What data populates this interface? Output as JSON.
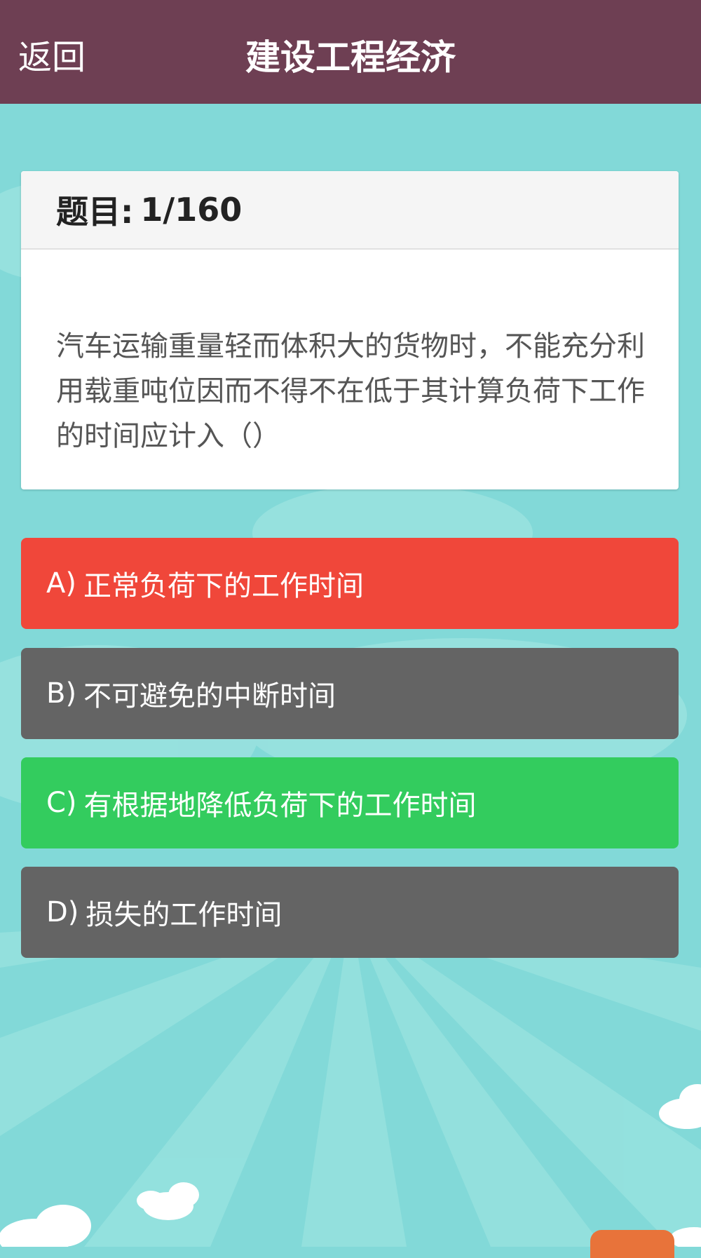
{
  "header": {
    "back_label": "返回",
    "title": "建设工程经济"
  },
  "question": {
    "counter_label": "题目:",
    "counter_value": "1/160",
    "text": "汽车运输重量轻而体积大的货物时，不能充分利用载重吨位因而不得不在低于其计算负荷下工作的时间应计入（）"
  },
  "options": [
    {
      "letter": "A)",
      "text": "正常负荷下的工作时间",
      "state": "wrong"
    },
    {
      "letter": "B)",
      "text": "不可避免的中断时间",
      "state": "neutral"
    },
    {
      "letter": "C)",
      "text": "有根据地降低负荷下的工作时间",
      "state": "correct"
    },
    {
      "letter": "D)",
      "text": "损失的工作时间",
      "state": "neutral"
    }
  ],
  "colors": {
    "header_bg": "#6e3f53",
    "page_bg": "#82d9d8",
    "wrong": "#f0473a",
    "correct": "#33cc5e",
    "neutral": "#646464",
    "corner_tab": "#e8733a"
  }
}
